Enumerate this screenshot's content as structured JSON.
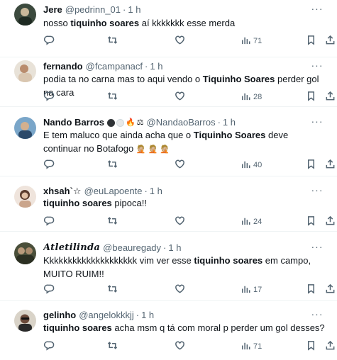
{
  "tweets": [
    {
      "name": "Jere",
      "handle": "@pedrinn_01",
      "sep": "·",
      "time": "1 h",
      "text_plain1": "nosso ",
      "text_bold": "tiquinho soares",
      "text_plain2": " aí kkkkkkk esse merda",
      "views": "71"
    },
    {
      "name": "fernando",
      "handle": "@fcampanacf",
      "sep": "·",
      "time": "1 h",
      "text_plain1": "podia ta no carna mas to aqui vendo o ",
      "text_bold": "Tiquinho Soares",
      "text_plain2": " perder gol na cara",
      "views": "28"
    },
    {
      "name": "Nando Barros",
      "handle": "@NandaoBarros",
      "sep": "·",
      "time": "1 h",
      "text_plain1": "E tem maluco que ainda acha que o ",
      "text_bold": "Tiquinho Soares",
      "text_plain2": " deve continuar no Botafogo",
      "emoji_tail": "🤦🏼 🤦🏼 🤦🏼",
      "views": "40"
    },
    {
      "name": "xhsah`☆",
      "handle": "@euLapoente",
      "sep": "·",
      "time": "1 h",
      "text_plain1": "",
      "text_bold": "tiquinho soares",
      "text_plain2": " pipoca!!",
      "views": "24"
    },
    {
      "name": "Atletilinda",
      "handle": "@beauregady",
      "sep": "·",
      "time": "1 h",
      "text_plain1": "Kkkkkkkkkkkkkkkkkkkk vim ver esse ",
      "text_bold": "tiquinho soares",
      "text_plain2": " em campo, MUITO RUIM!!",
      "views": "17"
    },
    {
      "name": "gelinho",
      "handle": "@angelokkkjj",
      "sep": "·",
      "time": "1 h",
      "text_plain1": "",
      "text_bold": "tiquinho soares",
      "text_plain2": " acha msm q tá com moral p perder um gol desses?",
      "views": "71"
    }
  ],
  "icons": {
    "reply": "reply-icon",
    "retweet": "retweet-icon",
    "like": "like-icon",
    "views": "views-icon",
    "bookmark": "bookmark-icon",
    "share": "share-icon",
    "more": "more-icon"
  },
  "colors": {
    "text": "#0f1419",
    "secondary": "#536471",
    "divider": "#eff3f4"
  }
}
